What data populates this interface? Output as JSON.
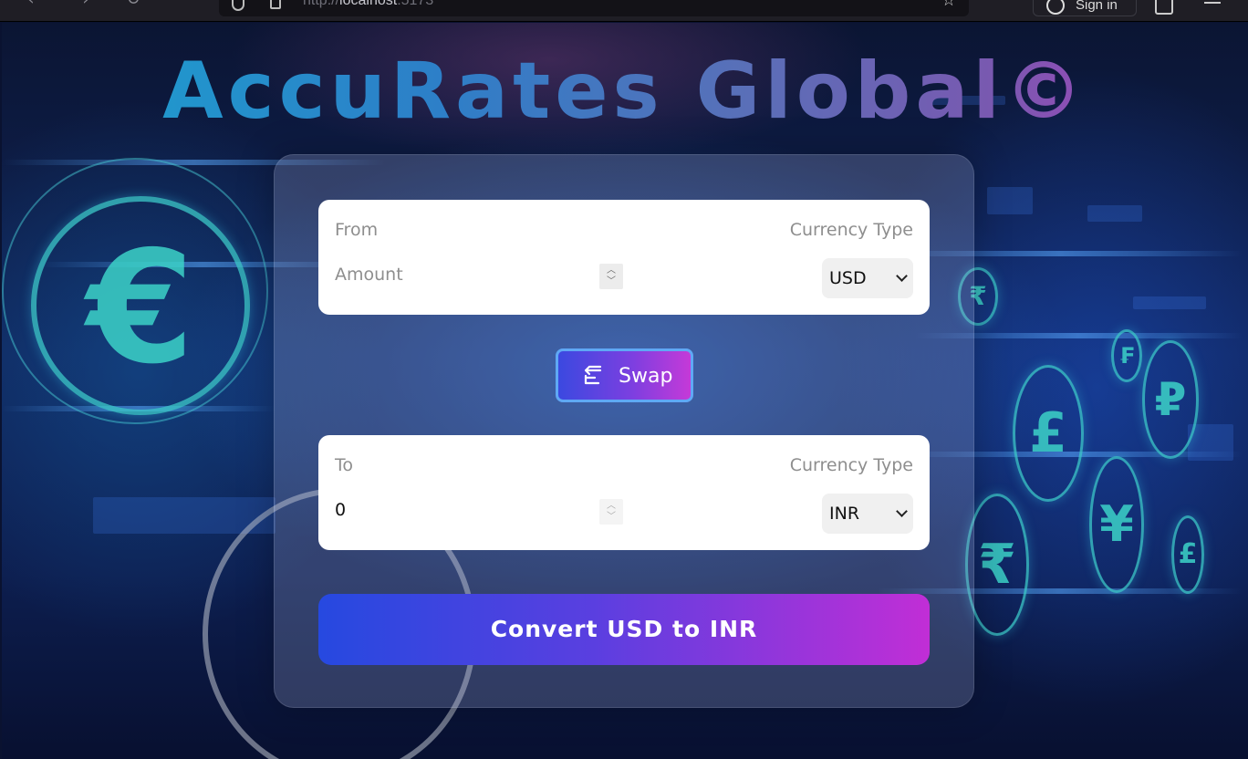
{
  "browser": {
    "url_prefix": "http://",
    "url_host": "localhost",
    "url_suffix": ":5173",
    "signin_label": "Sign in"
  },
  "app": {
    "title": "AccuRates Global©"
  },
  "from_box": {
    "label": "From",
    "currency_label": "Currency Type",
    "amount_placeholder": "Amount",
    "amount_value": "",
    "currency": "USD"
  },
  "swap_button": {
    "label": "Swap"
  },
  "to_box": {
    "label": "To",
    "currency_label": "Currency Type",
    "amount_value": "0",
    "currency": "INR"
  },
  "convert_button": {
    "label": "Convert USD to INR"
  },
  "colors": {
    "button_gradient_start": "#2649e0",
    "button_gradient_end": "#c12ed6",
    "swap_border": "#5fa8f5"
  },
  "background_icons": [
    "euro-coin-icon",
    "rupee-coin-icon",
    "pound-coin-icon",
    "yen-coin-icon",
    "ruble-coin-icon",
    "franc-coin-icon"
  ]
}
